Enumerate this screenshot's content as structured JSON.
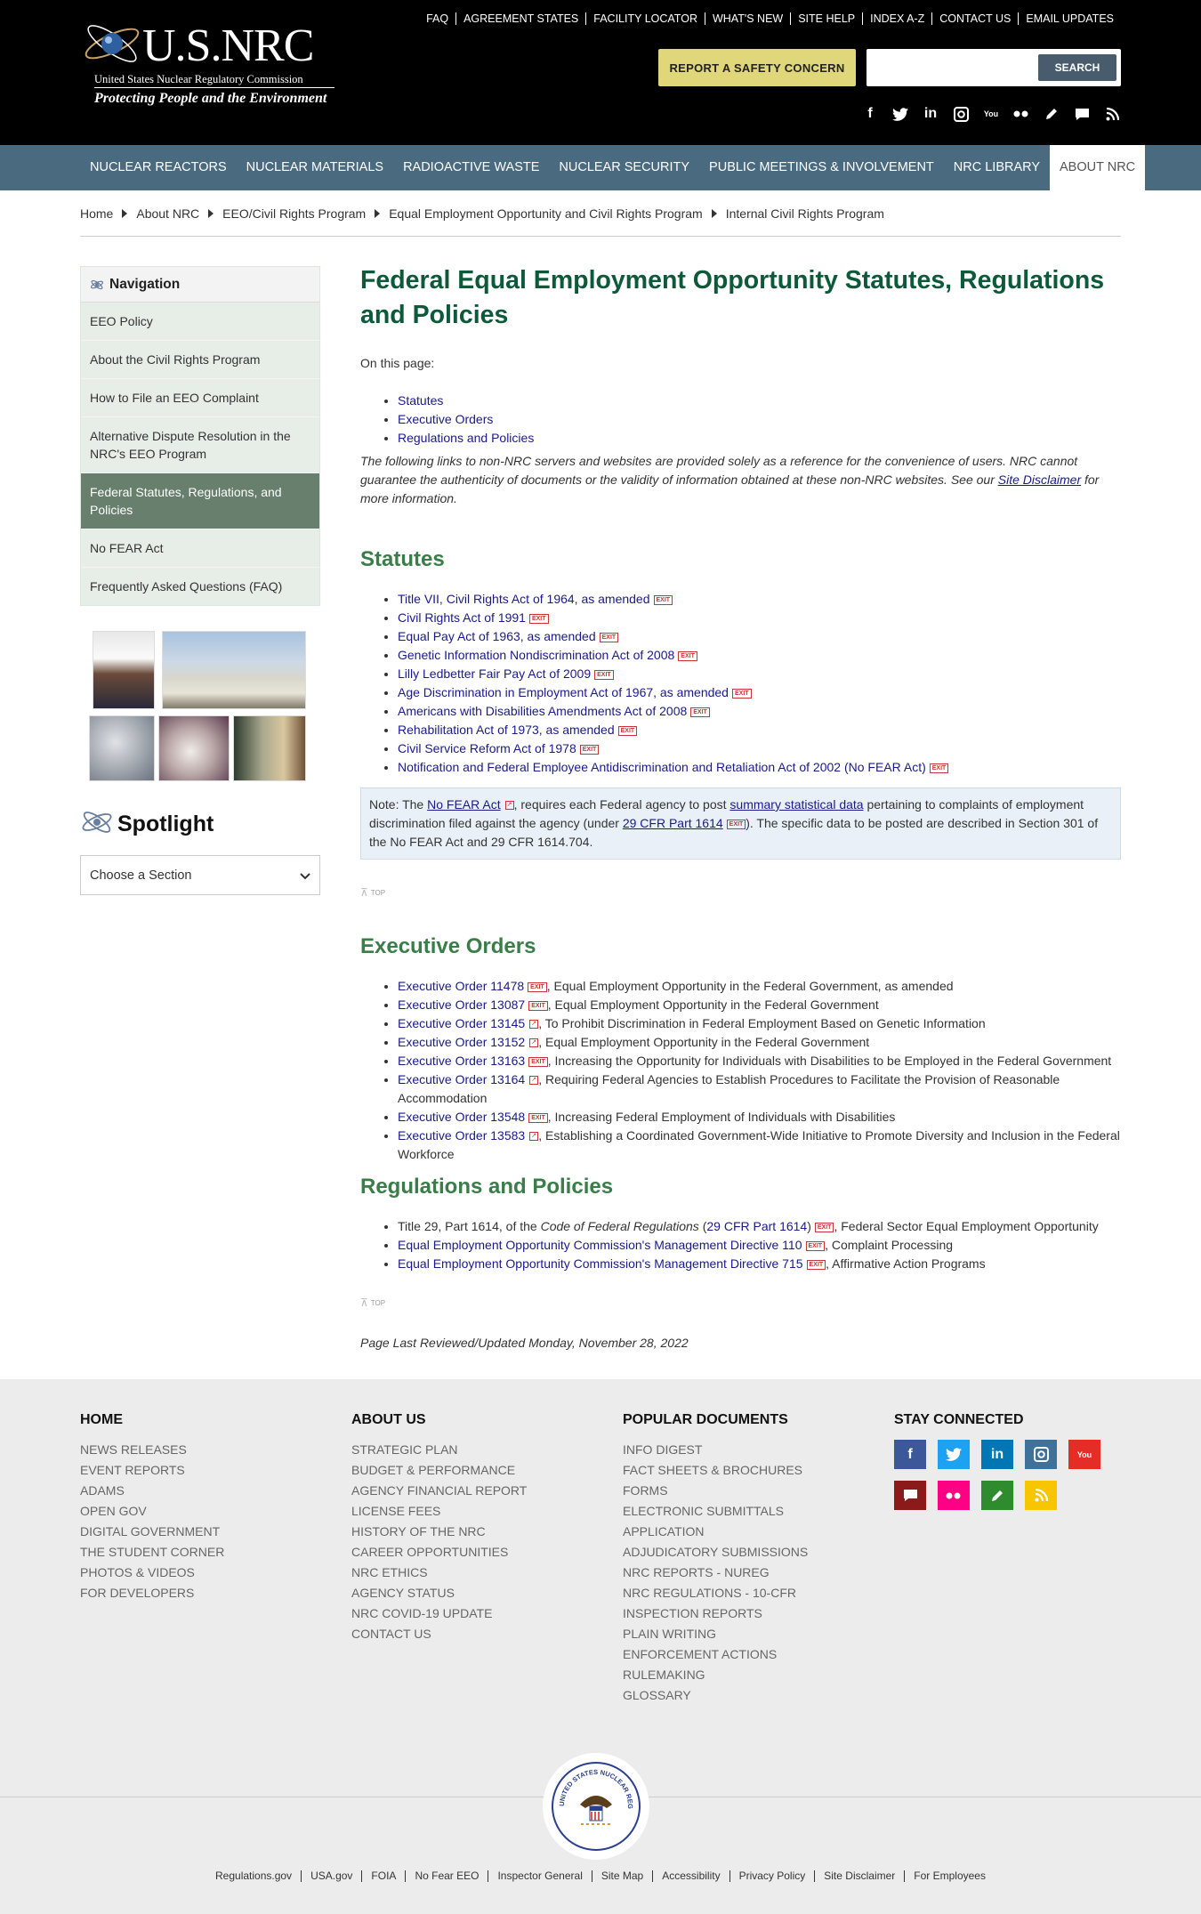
{
  "header": {
    "logo_text": "U.S.NRC",
    "logo_subtitle": "United States Nuclear Regulatory Commission",
    "logo_tagline": "Protecting People and the Environment",
    "util_links": [
      "FAQ",
      "AGREEMENT STATES",
      "FACILITY LOCATOR",
      "WHAT'S NEW",
      "SITE HELP",
      "INDEX A-Z",
      "CONTACT US",
      "EMAIL UPDATES"
    ],
    "report_button": "REPORT A SAFETY CONCERN",
    "search_placeholder": "",
    "search_button": "SEARCH",
    "social_icons": [
      "facebook-icon",
      "twitter-icon",
      "linkedin-icon",
      "instagram-icon",
      "youtube-icon",
      "flickr-icon",
      "blog-icon",
      "comment-icon",
      "rss-icon"
    ]
  },
  "main_nav": [
    "NUCLEAR REACTORS",
    "NUCLEAR MATERIALS",
    "RADIOACTIVE WASTE",
    "NUCLEAR SECURITY",
    "PUBLIC MEETINGS & INVOLVEMENT",
    "NRC LIBRARY",
    "ABOUT NRC"
  ],
  "main_nav_active": "ABOUT NRC",
  "breadcrumb": [
    "Home",
    "About NRC",
    "EEO/Civil Rights Program",
    "Equal Employment Opportunity and Civil Rights Program",
    "Internal Civil Rights Program"
  ],
  "sidebar": {
    "nav_title": "Navigation",
    "items": [
      "EEO Policy",
      "About the Civil Rights Program",
      "How to File an EEO Complaint",
      "Alternative Dispute Resolution in the NRC's EEO Program",
      "Federal Statutes, Regulations, and Policies",
      "No FEAR Act",
      "Frequently Asked Questions (FAQ)"
    ],
    "active_index": 4,
    "spotlight_title": "Spotlight",
    "choose_label": "Choose a Section"
  },
  "main": {
    "title": "Federal Equal Employment Opportunity Statutes, Regulations and Policies",
    "on_this_page": "On this page:",
    "toc": [
      "Statutes",
      "Executive Orders",
      "Regulations and Policies"
    ],
    "disclaimer_before": "The following links to non-NRC servers and websites are provided solely as a reference for the convenience of users. NRC cannot guarantee the authenticity of documents or the validity of information obtained at these non-NRC websites. See our ",
    "disclaimer_link": "Site Disclaimer",
    "disclaimer_after": " for more information.",
    "statutes_heading": "Statutes",
    "statutes": [
      "Title VII, Civil Rights Act of 1964, as amended",
      "Civil Rights Act of 1991",
      "Equal Pay Act of 1963, as amended",
      "Genetic Information Nondiscrimination Act of 2008",
      "Lilly Ledbetter Fair Pay Act of 2009",
      "Age Discrimination in Employment Act of 1967, as amended",
      "Americans with Disabilities Amendments Act of 2008",
      "Rehabilitation Act of 1973, as amended",
      "Civil Service Reform Act of 1978",
      "Notification and Federal Employee Antidiscrimination and Retaliation Act of 2002 (No FEAR Act)"
    ],
    "note": {
      "t1": "Note: The ",
      "l1": "No FEAR Act",
      "t2": ", requires each Federal agency to post ",
      "l2": "summary statistical data",
      "t3": " pertaining to complaints of employment discrimination filed against the agency (under ",
      "l3": "29 CFR Part 1614",
      "t4": "). The specific data to be posted are described in Section 301 of the No FEAR Act and 29 CFR 1614.704."
    },
    "top_label": "TOP",
    "eo_heading": "Executive Orders",
    "executive_orders": [
      {
        "link": "Executive Order 11478",
        "text": ", Equal Employment Opportunity in the Federal Government, as amended",
        "badge": "exit"
      },
      {
        "link": "Executive Order 13087",
        "text": ", Equal Employment Opportunity in the Federal Government",
        "badge": "exit"
      },
      {
        "link": "Executive Order 13145",
        "text": ", To Prohibit Discrimination in Federal Employment Based on Genetic Information",
        "badge": "ext"
      },
      {
        "link": "Executive Order 13152",
        "text": ", Equal Employment Opportunity in the Federal Government",
        "badge": "ext"
      },
      {
        "link": "Executive Order 13163",
        "text": ", Increasing the Opportunity for Individuals with Disabilities to be Employed in the Federal Government",
        "badge": "exit"
      },
      {
        "link": "Executive Order 13164",
        "text": ", Requiring Federal Agencies to Establish Procedures to Facilitate the Provision of Reasonable Accommodation",
        "badge": "ext"
      },
      {
        "link": "Executive Order 13548",
        "text": ", Increasing Federal Employment of Individuals with Disabilities",
        "badge": "exit"
      },
      {
        "link": "Executive Order 13583",
        "text": ", Establishing a Coordinated Government-Wide Initiative to Promote Diversity and Inclusion in the Federal Workforce",
        "badge": "ext"
      }
    ],
    "reg_heading": "Regulations and Policies",
    "reg1_prefix": "Title 29, Part 1614, of the ",
    "reg1_italic": "Code of Federal Regulations",
    "reg1_open": " (",
    "reg1_link": "29 CFR Part 1614",
    "reg1_close": ")",
    "reg1_suffix": ", Federal Sector Equal Employment Opportunity",
    "regs": [
      {
        "link": "Equal Employment Opportunity Commission's Management Directive 110",
        "text": ", Complaint Processing"
      },
      {
        "link": "Equal Employment Opportunity Commission's Management Directive 715",
        "text": ", Affirmative Action Programs"
      }
    ],
    "exit_label": "EXIT",
    "reviewed": "Page Last Reviewed/Updated Monday, November 28, 2022"
  },
  "footer": {
    "col1": {
      "title": "HOME",
      "links": [
        "NEWS RELEASES",
        "EVENT REPORTS",
        "ADAMS",
        "OPEN GOV",
        "DIGITAL GOVERNMENT",
        "THE STUDENT CORNER",
        "PHOTOS & VIDEOS",
        "FOR DEVELOPERS"
      ]
    },
    "col2": {
      "title": "ABOUT US",
      "links": [
        "STRATEGIC PLAN",
        "BUDGET & PERFORMANCE",
        "AGENCY FINANCIAL REPORT",
        "LICENSE FEES",
        "HISTORY OF THE NRC",
        "CAREER OPPORTUNITIES",
        "NRC ETHICS",
        "AGENCY STATUS",
        "NRC COVID-19 UPDATE",
        "CONTACT US"
      ]
    },
    "col3": {
      "title": "POPULAR DOCUMENTS",
      "links": [
        "INFO DIGEST",
        "FACT SHEETS & BROCHURES",
        "FORMS",
        "ELECTRONIC SUBMITTALS",
        "APPLICATION",
        "ADJUDICATORY SUBMISSIONS",
        "NRC REPORTS - NUREG",
        "NRC REGULATIONS - 10-CFR",
        "INSPECTION REPORTS",
        "PLAIN WRITING",
        "ENFORCEMENT ACTIONS",
        "RULEMAKING",
        "GLOSSARY"
      ]
    },
    "col4": {
      "title": "STAY CONNECTED"
    },
    "social": [
      {
        "icon": "facebook-icon",
        "color": "#3b5998"
      },
      {
        "icon": "twitter-icon",
        "color": "#1da1f2"
      },
      {
        "icon": "linkedin-icon",
        "color": "#0077b5"
      },
      {
        "icon": "instagram-icon",
        "color": "#3f729b"
      },
      {
        "icon": "youtube-icon",
        "color": "#e52d27"
      },
      {
        "icon": "comment-icon",
        "color": "#8b1a1a"
      },
      {
        "icon": "flickr-icon",
        "color": "#ff0084"
      },
      {
        "icon": "blog-icon",
        "color": "#2e8b2e"
      },
      {
        "icon": "rss-icon",
        "color": "#f7c600"
      }
    ],
    "seal_text": "UNITED STATES NUCLEAR REGULATORY COMMISSION",
    "bottom_links": [
      "Regulations.gov",
      "USA.gov",
      "FOIA",
      "No Fear EEO",
      "Inspector General",
      "Site Map",
      "Accessibility",
      "Privacy Policy",
      "Site Disclaimer",
      "For Employees"
    ]
  }
}
